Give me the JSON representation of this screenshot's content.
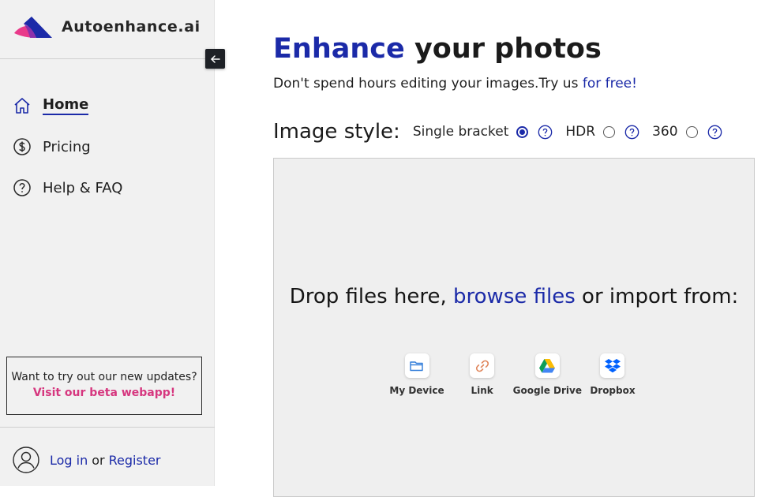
{
  "brand": {
    "name": "Autoenhance.ai"
  },
  "sidebar": {
    "items": [
      {
        "label": "Home",
        "icon": "home-icon",
        "active": true
      },
      {
        "label": "Pricing",
        "icon": "dollar-icon"
      },
      {
        "label": "Help & FAQ",
        "icon": "question-icon"
      }
    ],
    "beta": {
      "question": "Want to try out our new updates?",
      "link": "Visit our beta webapp!"
    },
    "account": {
      "login": "Log in",
      "or": "or",
      "register": "Register"
    }
  },
  "main": {
    "title_accent": "Enhance",
    "title_rest": "your photos",
    "subtitle": "Don't spend hours editing your images.Try us",
    "subtitle_free": "for free!",
    "style_label": "Image style:",
    "options": [
      {
        "label": "Single bracket",
        "selected": true
      },
      {
        "label": "HDR",
        "selected": false
      },
      {
        "label": "360",
        "selected": false
      }
    ],
    "drop": {
      "before": "Drop files here,",
      "browse": "browse files",
      "after": "or import from:"
    },
    "sources": [
      {
        "label": "My Device",
        "icon": "folder-icon"
      },
      {
        "label": "Link",
        "icon": "link-icon"
      },
      {
        "label": "Google Drive",
        "icon": "google-drive-icon"
      },
      {
        "label": "Dropbox",
        "icon": "dropbox-icon"
      }
    ]
  },
  "colors": {
    "accent": "#1b2aa8",
    "pink": "#d6377f",
    "sidebar_bg": "#f1f1f1"
  }
}
